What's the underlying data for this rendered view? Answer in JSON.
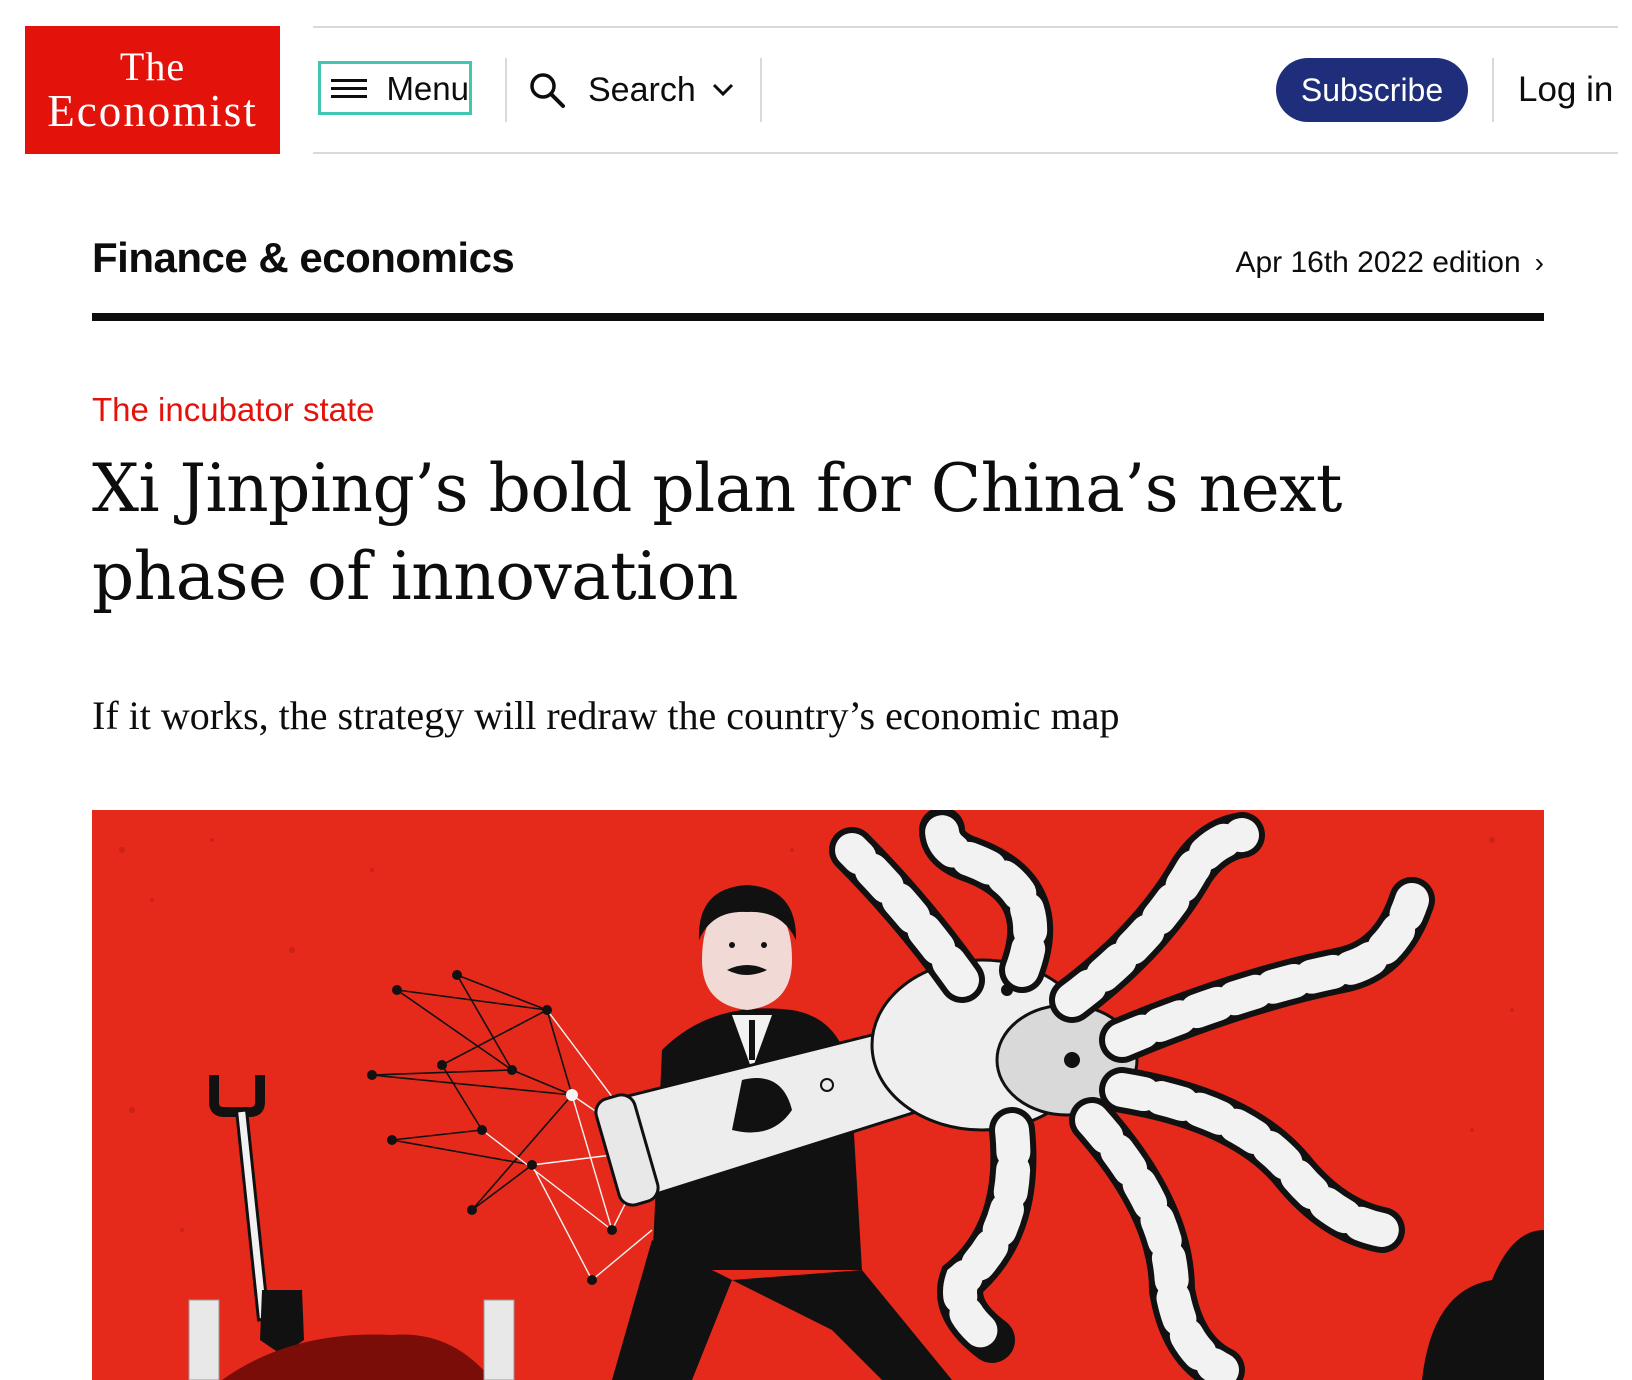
{
  "brand": {
    "line1": "The",
    "line2": "Economist",
    "color": "#e3120b"
  },
  "nav": {
    "menu_label": "Menu",
    "search_label": "Search",
    "subscribe_label": "Subscribe",
    "login_label": "Log in",
    "subscribe_color": "#1f2e7a",
    "focus_outline_color": "#3fc7b4"
  },
  "section": {
    "name": "Finance & economics",
    "edition": "Apr 16th 2022 edition",
    "edition_arrow": "›"
  },
  "article": {
    "rubric": "The incubator state",
    "headline": "Xi Jinping’s bold plan for China’s next phase of innovation",
    "standfirst": "If it works, the strategy will redraw the country’s economic map",
    "rubric_color": "#e3120b"
  },
  "hero_image": {
    "background_color": "#e52a1c"
  }
}
